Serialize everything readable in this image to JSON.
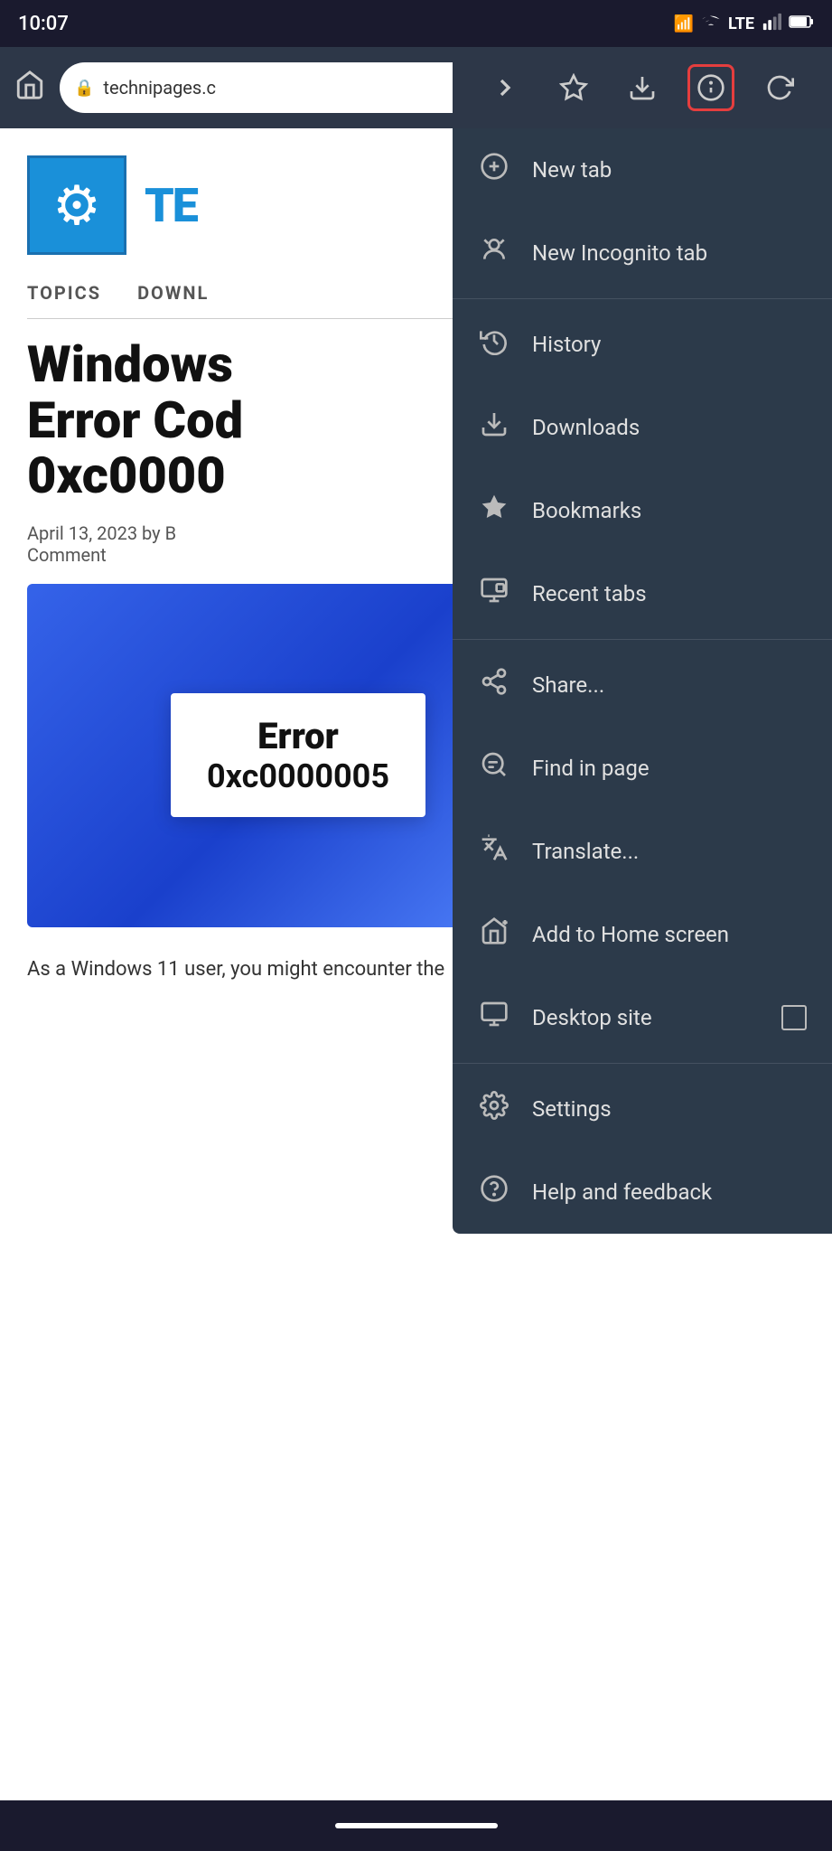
{
  "statusBar": {
    "time": "10:07",
    "lte": "LTE"
  },
  "browserChrome": {
    "homeLabel": "home",
    "url": "technipages.c",
    "lockIcon": "🔒"
  },
  "toolbar": {
    "forwardBtn": "→",
    "bookmarkBtn": "☆",
    "downloadBtn": "⬇",
    "infoBtn": "ⓘ",
    "refreshBtn": "↻"
  },
  "pageContent": {
    "siteName": "TE",
    "topicsLabel": "TOPICS",
    "downloadLabel": "DOWNL",
    "articleTitle": "Windows Error Cod 0xc0000",
    "articleDate": "April 13, 2023 by B",
    "articleComment": "Comment",
    "errorTitle": "Error",
    "errorCode": "0xc0000005",
    "articleIntro": "As a Windows 11 user, you might encounter the"
  },
  "menu": {
    "items": [
      {
        "id": "new-tab",
        "label": "New tab",
        "icon": "plus-circle"
      },
      {
        "id": "new-incognito-tab",
        "label": "New Incognito tab",
        "icon": "incognito"
      },
      {
        "id": "history",
        "label": "History",
        "icon": "history"
      },
      {
        "id": "downloads",
        "label": "Downloads",
        "icon": "downloads"
      },
      {
        "id": "bookmarks",
        "label": "Bookmarks",
        "icon": "star"
      },
      {
        "id": "recent-tabs",
        "label": "Recent tabs",
        "icon": "recent-tabs"
      },
      {
        "id": "share",
        "label": "Share...",
        "icon": "share"
      },
      {
        "id": "find-in-page",
        "label": "Find in page",
        "icon": "find"
      },
      {
        "id": "translate",
        "label": "Translate...",
        "icon": "translate"
      },
      {
        "id": "add-to-home",
        "label": "Add to Home screen",
        "icon": "add-home"
      },
      {
        "id": "desktop-site",
        "label": "Desktop site",
        "icon": "desktop",
        "hasCheckbox": true
      },
      {
        "id": "settings",
        "label": "Settings",
        "icon": "gear"
      },
      {
        "id": "help-feedback",
        "label": "Help and feedback",
        "icon": "help"
      }
    ]
  }
}
